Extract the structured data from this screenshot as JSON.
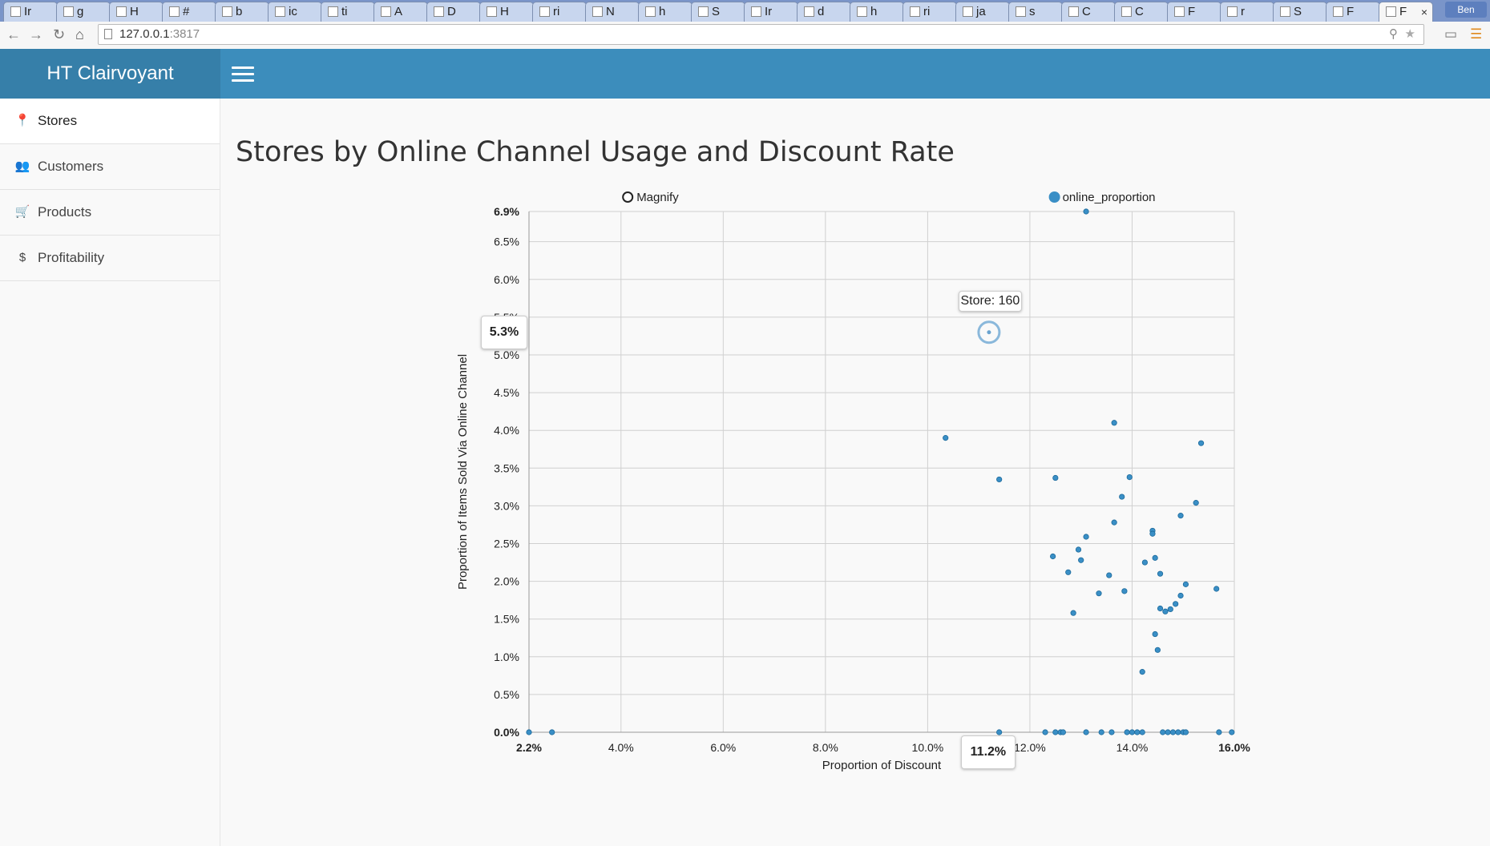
{
  "browser": {
    "tabs": [
      {
        "label": "Ir"
      },
      {
        "label": "g"
      },
      {
        "label": "H"
      },
      {
        "label": "#"
      },
      {
        "label": "b"
      },
      {
        "label": "ic"
      },
      {
        "label": "ti"
      },
      {
        "label": "A"
      },
      {
        "label": "D"
      },
      {
        "label": "H"
      },
      {
        "label": "ri"
      },
      {
        "label": "N"
      },
      {
        "label": "h"
      },
      {
        "label": "S"
      },
      {
        "label": "Ir"
      },
      {
        "label": "d"
      },
      {
        "label": "h"
      },
      {
        "label": "ri"
      },
      {
        "label": "ja"
      },
      {
        "label": "s"
      },
      {
        "label": "C"
      },
      {
        "label": "C"
      },
      {
        "label": "F"
      },
      {
        "label": "r"
      },
      {
        "label": "S"
      },
      {
        "label": "F"
      },
      {
        "label": "F"
      }
    ],
    "close_tab": "×",
    "profile": "Ben",
    "url_host": "127.0.0.1",
    "url_port": ":3817"
  },
  "app": {
    "brand": "HT Clairvoyant",
    "sidebar": [
      {
        "label": "Stores",
        "icon": "map-marker-icon",
        "glyph": "📍"
      },
      {
        "label": "Customers",
        "icon": "users-icon",
        "glyph": "👥"
      },
      {
        "label": "Products",
        "icon": "shopping-cart-icon",
        "glyph": "🛒"
      },
      {
        "label": "Profitability",
        "icon": "dollar-icon",
        "glyph": "$"
      }
    ],
    "page_title": "Stores by Online Channel Usage and Discount Rate"
  },
  "chart_data": {
    "type": "scatter",
    "title": "",
    "xlabel": "Proportion of Discount",
    "ylabel": "Proportion of Items Sold Via Online Channel",
    "xlim": [
      2.2,
      16.0
    ],
    "ylim": [
      0.0,
      6.9
    ],
    "x_ticks": [
      "2.2%",
      "4.0%",
      "6.0%",
      "8.0%",
      "10.0%",
      "12.0%",
      "14.0%",
      "16.0%"
    ],
    "y_ticks": [
      "0.0%",
      "0.5%",
      "1.0%",
      "1.5%",
      "2.0%",
      "2.5%",
      "3.0%",
      "3.5%",
      "4.0%",
      "4.5%",
      "5.0%",
      "5.5%",
      "6.0%",
      "6.5%",
      "6.9%"
    ],
    "grid": true,
    "legend": [
      {
        "name": "Magnify",
        "style": "hollow",
        "position": "top-center"
      },
      {
        "name": "online_proportion",
        "style": "filled",
        "position": "top-right"
      }
    ],
    "point_color": "#3a8fc6",
    "series": [
      {
        "name": "online_proportion",
        "points": [
          [
            2.2,
            0.0
          ],
          [
            2.65,
            0.0
          ],
          [
            11.4,
            0.0
          ],
          [
            12.3,
            0.0
          ],
          [
            12.5,
            0.0
          ],
          [
            12.6,
            0.0
          ],
          [
            12.65,
            0.0
          ],
          [
            13.1,
            0.0
          ],
          [
            13.4,
            0.0
          ],
          [
            13.6,
            0.0
          ],
          [
            13.9,
            0.0
          ],
          [
            14.0,
            0.0
          ],
          [
            14.1,
            0.0
          ],
          [
            14.2,
            0.0
          ],
          [
            14.6,
            0.0
          ],
          [
            14.7,
            0.0
          ],
          [
            14.8,
            0.0
          ],
          [
            14.9,
            0.0
          ],
          [
            15.0,
            0.0
          ],
          [
            15.05,
            0.0
          ],
          [
            15.7,
            0.0
          ],
          [
            15.95,
            0.0
          ],
          [
            13.1,
            6.9
          ],
          [
            13.65,
            4.1
          ],
          [
            10.35,
            3.9
          ],
          [
            15.35,
            3.83
          ],
          [
            11.4,
            3.35
          ],
          [
            12.5,
            3.37
          ],
          [
            13.95,
            3.38
          ],
          [
            13.8,
            3.12
          ],
          [
            15.25,
            3.04
          ],
          [
            14.95,
            2.87
          ],
          [
            13.65,
            2.78
          ],
          [
            14.4,
            2.67
          ],
          [
            14.4,
            2.63
          ],
          [
            13.1,
            2.59
          ],
          [
            12.95,
            2.42
          ],
          [
            12.45,
            2.33
          ],
          [
            13.0,
            2.28
          ],
          [
            14.45,
            2.31
          ],
          [
            14.25,
            2.25
          ],
          [
            12.75,
            2.12
          ],
          [
            13.55,
            2.08
          ],
          [
            14.55,
            2.1
          ],
          [
            15.05,
            1.96
          ],
          [
            15.65,
            1.9
          ],
          [
            13.85,
            1.87
          ],
          [
            13.35,
            1.84
          ],
          [
            14.95,
            1.81
          ],
          [
            14.85,
            1.7
          ],
          [
            14.55,
            1.64
          ],
          [
            14.65,
            1.6
          ],
          [
            14.75,
            1.63
          ],
          [
            12.85,
            1.58
          ],
          [
            14.45,
            1.3
          ],
          [
            14.5,
            1.09
          ],
          [
            14.2,
            0.8
          ]
        ]
      }
    ],
    "magnify": {
      "label": "Store: 160",
      "x": 11.2,
      "y": 5.3,
      "x_readout": "11.2%",
      "y_readout": "5.3%"
    }
  }
}
